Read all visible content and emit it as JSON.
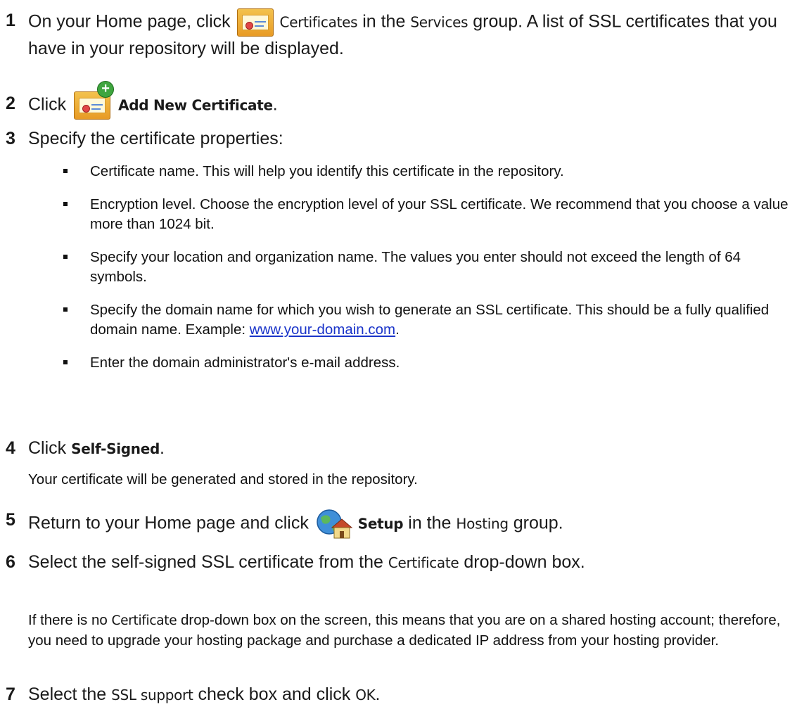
{
  "steps": {
    "s1": {
      "num": "1",
      "pre": "On your Home page, click",
      "ui1": "Certificates",
      "mid": "in the",
      "ui2": "Services",
      "post": "group. A list of SSL certificates that you have in your repository will be displayed."
    },
    "s2": {
      "num": "2",
      "pre": "Click",
      "ui1": "Add New Certificate",
      "post": "."
    },
    "s3": {
      "num": "3",
      "text": "Specify the certificate properties:"
    },
    "s4": {
      "num": "4",
      "pre": "Click",
      "ui1": "Self-Signed",
      "post": "."
    },
    "s5": {
      "num": "5",
      "pre": "Return to your Home page and click",
      "ui1": "Setup",
      "mid": "in the",
      "ui2": "Hosting",
      "post": "group."
    },
    "s6": {
      "num": "6",
      "pre": "Select the self-signed SSL certificate from the",
      "ui1": "Certificate",
      "post": "drop-down box."
    },
    "s7": {
      "num": "7",
      "pre": "Select the",
      "ui1": "SSL support",
      "mid": "check box and click",
      "ui2": "OK",
      "post": "."
    }
  },
  "bullets": {
    "b1": "Certificate name. This will help you identify this certificate in the repository.",
    "b2": "Encryption level. Choose the encryption level of your SSL certificate. We recommend that you choose a value more than 1024 bit.",
    "b3": "Specify your location and organization name. The values you enter should not exceed the length of 64 symbols.",
    "b4_pre": "Specify the domain name for which you wish to generate an SSL certificate. This should be a fully qualified domain name. Example:",
    "b4_link": "www.your-domain.com",
    "b4_post": ".",
    "b5": "Enter the domain administrator's e-mail address."
  },
  "notes": {
    "after4": "Your certificate will be generated and stored in the repository.",
    "after6_pre": "If there is no",
    "after6_ui": "Certificate",
    "after6_post": "drop-down box on the screen, this means that you are on a shared hosting account; therefore, you need to upgrade your hosting package and purchase a dedicated IP address from your hosting provider."
  },
  "icons": {
    "certificates": "certificate-icon",
    "add_new_certificate": "add-certificate-icon",
    "setup": "globe-house-icon"
  }
}
